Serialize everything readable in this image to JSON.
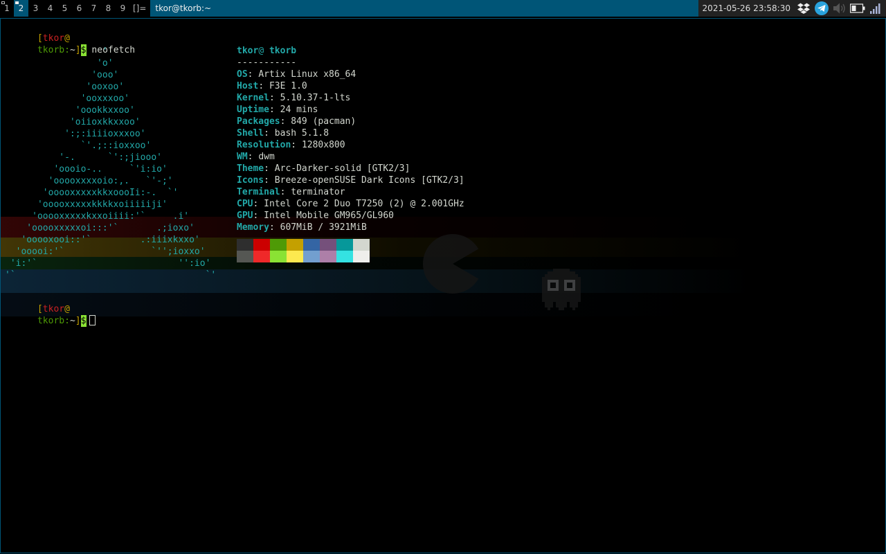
{
  "bar": {
    "tags": [
      {
        "label": "1",
        "active": false,
        "occupied": true
      },
      {
        "label": "2",
        "active": true,
        "occupied": true
      },
      {
        "label": "3",
        "active": false,
        "occupied": false
      },
      {
        "label": "4",
        "active": false,
        "occupied": false
      },
      {
        "label": "5",
        "active": false,
        "occupied": false
      },
      {
        "label": "6",
        "active": false,
        "occupied": false
      },
      {
        "label": "7",
        "active": false,
        "occupied": false
      },
      {
        "label": "8",
        "active": false,
        "occupied": false
      },
      {
        "label": "9",
        "active": false,
        "occupied": false
      }
    ],
    "layout_symbol": "[]=",
    "window_title": "tkor@tkorb:~",
    "datetime": "2021-05-26 23:58:30",
    "tray_icons": [
      "dropbox-icon",
      "telegram-icon",
      "volume-icon",
      "battery-icon",
      "wifi-signal-icon"
    ],
    "colors": {
      "selected": "#005577",
      "normal_fg": "#bbbbbb",
      "selected_fg": "#eeeeee"
    }
  },
  "terminal": {
    "prompt1": {
      "user": "tkor",
      "at": "@",
      "host": "tkorb",
      "path": "~",
      "symbol": "$",
      "command": "neofetch"
    },
    "logo": "                  '\n                 'o'\n                'ooo'\n               'ooxoo'\n              'ooxxxoo'\n             'oookkxxoo'\n            'oiioxkkxxoo'\n           ':;:iiiioxxxoo'\n              `'.;::ioxxoo'\n          '-.      `':;jiooo'\n         'oooio-..     `'i:io'\n        'ooooxxxxoio:,.   `'-;'\n       'ooooxxxxxkkxoooIi:-.  `'\n      'ooooxxxxxkkkkxoiiiiiji'\n     'ooooxxxxxkxxoiiii:'`     .i'\n    'ooooxxxxxoi:::'`       .;ioxo'\n   'ooooxooi::'`         .:iiixkxxo'\n  'ooooi:'`                `'';ioxxo'\n 'i:'`                          '':io'\n'`                                   `'",
    "neofetch": {
      "user": "tkor",
      "host": "tkorb",
      "separator": "-----------",
      "fields": [
        {
          "key": "OS",
          "value": "Artix Linux x86_64"
        },
        {
          "key": "Host",
          "value": "F3E 1.0"
        },
        {
          "key": "Kernel",
          "value": "5.10.37-1-lts"
        },
        {
          "key": "Uptime",
          "value": "24 mins"
        },
        {
          "key": "Packages",
          "value": "849 (pacman)"
        },
        {
          "key": "Shell",
          "value": "bash 5.1.8"
        },
        {
          "key": "Resolution",
          "value": "1280x800"
        },
        {
          "key": "WM",
          "value": "dwm"
        },
        {
          "key": "Theme",
          "value": "Arc-Darker-solid [GTK2/3]"
        },
        {
          "key": "Icons",
          "value": "Breeze-openSUSE Dark Icons [GTK2/3]"
        },
        {
          "key": "Terminal",
          "value": "terminator"
        },
        {
          "key": "CPU",
          "value": "Intel Core 2 Duo T7250 (2) @ 2.001GHz"
        },
        {
          "key": "GPU",
          "value": "Intel Mobile GM965/GL960"
        },
        {
          "key": "Memory",
          "value": "607MiB / 3921MiB"
        }
      ],
      "palette_normal": [
        "#2e2e2e",
        "#cc0000",
        "#4e9a06",
        "#c4a000",
        "#3465a4",
        "#75507b",
        "#06989a",
        "#d3d7cf"
      ],
      "palette_bright": [
        "#555753",
        "#ef2929",
        "#8ae234",
        "#fce94f",
        "#729fcf",
        "#ad7fa8",
        "#34e2e2",
        "#eeeeec"
      ]
    },
    "prompt2": {
      "user": "tkor",
      "at": "@",
      "host": "tkorb",
      "path": "~",
      "symbol": "$"
    }
  }
}
